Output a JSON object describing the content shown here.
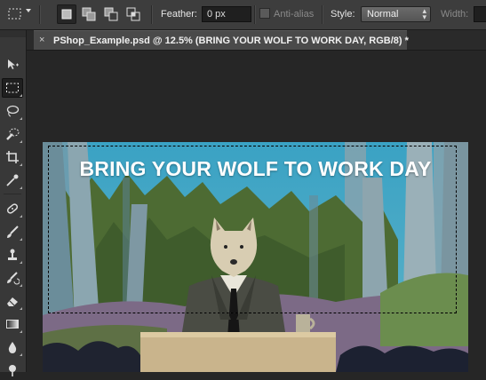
{
  "options_bar": {
    "feather_label": "Feather:",
    "feather_value": "0 px",
    "antialias_label": "Anti-alias",
    "style_label": "Style:",
    "style_value": "Normal",
    "width_label": "Width:"
  },
  "document": {
    "tab_close": "×",
    "tab_title": "PShop_Example.psd @ 12.5% (BRING YOUR WOLF TO WORK DAY, RGB/8) *"
  },
  "canvas": {
    "poster_text": "BRING YOUR WOLF TO WORK DAY"
  },
  "tools": [
    "move-icon",
    "rectangular-marquee-icon",
    "lasso-icon",
    "quick-selection-icon",
    "crop-icon",
    "eyedropper-icon",
    "spot-healing-icon",
    "brush-icon",
    "clone-stamp-icon",
    "history-brush-icon",
    "eraser-icon",
    "gradient-icon",
    "blur-icon",
    "dodge-icon"
  ],
  "colors": {
    "panel": "#3d3d3d",
    "workspace": "#262626",
    "sky": "#3a8fb0",
    "forest": "#4d6b33"
  }
}
